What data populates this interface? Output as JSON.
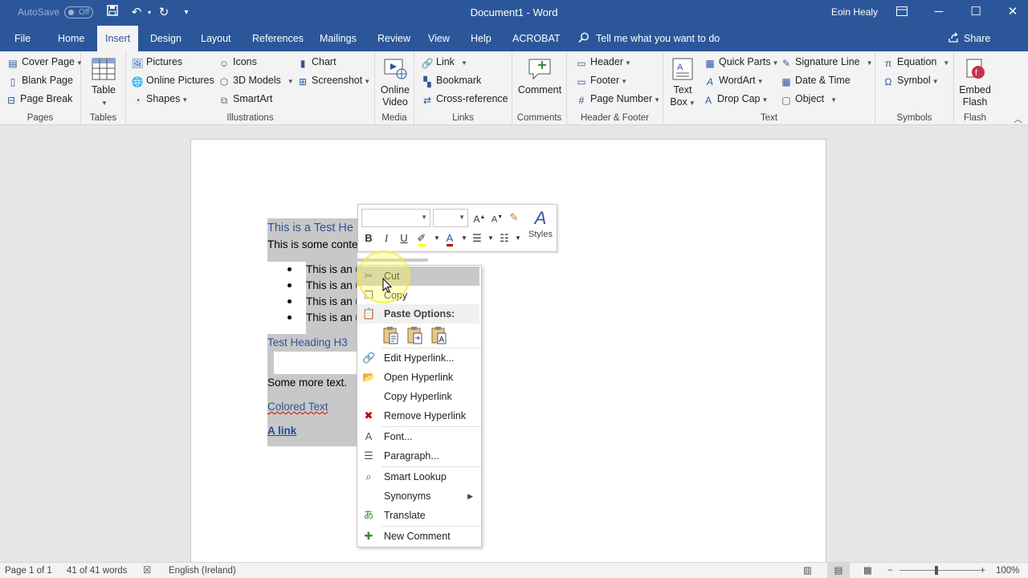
{
  "titlebar": {
    "autosave": "AutoSave",
    "autosave_state": "Off",
    "document_title": "Document1 - Word",
    "user": "Eoin Healy"
  },
  "tabs": [
    "File",
    "Home",
    "Insert",
    "Design",
    "Layout",
    "References",
    "Mailings",
    "Review",
    "View",
    "Help",
    "ACROBAT"
  ],
  "active_tab": "Insert",
  "tell_me": "Tell me what you want to do",
  "share": "Share",
  "ribbon": {
    "pages": {
      "label": "Pages",
      "items": [
        "Cover Page",
        "Blank Page",
        "Page Break"
      ]
    },
    "tables": {
      "label": "Tables",
      "table": "Table"
    },
    "illustrations": {
      "label": "Illustrations",
      "items": [
        "Pictures",
        "Online Pictures",
        "Shapes",
        "Icons",
        "3D Models",
        "SmartArt",
        "Chart",
        "Screenshot"
      ]
    },
    "media": {
      "label": "Media",
      "online_video_1": "Online",
      "online_video_2": "Video"
    },
    "links": {
      "label": "Links",
      "items": [
        "Link",
        "Bookmark",
        "Cross-reference"
      ]
    },
    "comments": {
      "label": "Comments",
      "comment": "Comment"
    },
    "header_footer": {
      "label": "Header & Footer",
      "items": [
        "Header",
        "Footer",
        "Page Number"
      ]
    },
    "text": {
      "label": "Text",
      "textbox_1": "Text",
      "textbox_2": "Box",
      "items": [
        "Quick Parts",
        "WordArt",
        "Drop Cap",
        "Signature Line",
        "Date & Time",
        "Object"
      ]
    },
    "symbols": {
      "label": "Symbols",
      "items": [
        "Equation",
        "Symbol"
      ]
    },
    "flash": {
      "label": "Flash",
      "embed_1": "Embed",
      "embed_2": "Flash"
    }
  },
  "document": {
    "heading1": "This is a Test He",
    "para1": "This is some conte",
    "bullets": [
      "This is an u",
      "This is an u",
      "This is an u",
      "This is an u"
    ],
    "heading3": "Test Heading H3",
    "more_text": "Some more text.",
    "colored_text": "Colored Text",
    "link_text": "A link"
  },
  "minibar": {
    "bold": "B",
    "italic": "I",
    "underline": "U",
    "styles": "Styles"
  },
  "context_menu": {
    "cut": "Cut",
    "copy": "Copy",
    "paste_options": "Paste Options:",
    "edit_hyperlink": "Edit Hyperlink...",
    "open_hyperlink": "Open Hyperlink",
    "copy_hyperlink": "Copy Hyperlink",
    "remove_hyperlink": "Remove Hyperlink",
    "font": "Font...",
    "paragraph": "Paragraph...",
    "smart_lookup": "Smart Lookup",
    "synonyms": "Synonyms",
    "translate": "Translate",
    "new_comment": "New Comment"
  },
  "statusbar": {
    "page": "Page 1 of 1",
    "words": "41 of 41 words",
    "language": "English (Ireland)",
    "zoom": "100%"
  },
  "colors": {
    "brand": "#2b579a",
    "selection": "#c8c8c8",
    "heading": "#2f5496"
  }
}
